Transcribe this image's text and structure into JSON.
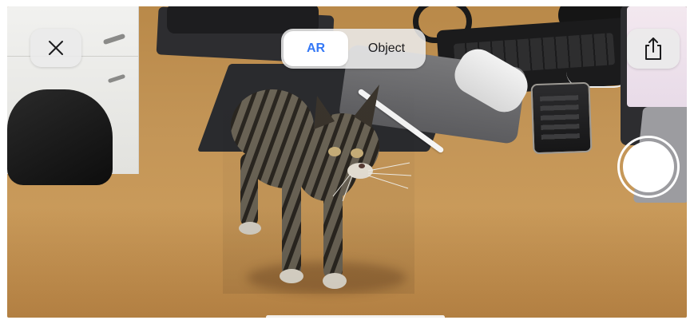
{
  "toolbar": {
    "close_icon": "close-icon",
    "share_icon": "share-icon"
  },
  "mode_toggle": {
    "options": [
      {
        "label": "AR",
        "selected": true
      },
      {
        "label": "Object",
        "selected": false
      }
    ],
    "selected_color": "#3478f6"
  },
  "scene": {
    "model": "cat-3d-model",
    "surface": "wooden-desk"
  },
  "shutter": {
    "icon": "shutter-button"
  }
}
